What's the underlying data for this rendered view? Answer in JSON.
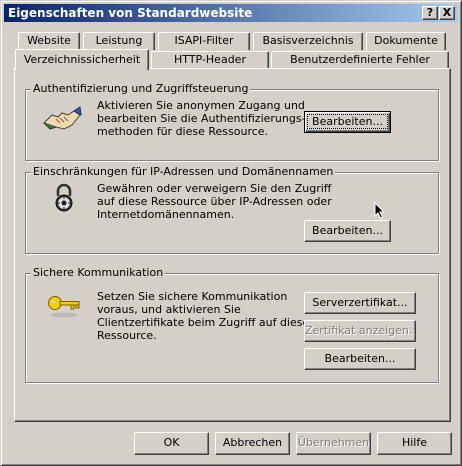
{
  "window": {
    "title": "Eigenschaften von Standardwebsite"
  },
  "title_buttons": {
    "help": "?",
    "close": "X"
  },
  "tabs_back": [
    "Website",
    "Leistung",
    "ISAPI-Filter",
    "Basisverzeichnis",
    "Dokumente"
  ],
  "tabs_front": [
    "Verzeichnissicherheit",
    "HTTP-Header",
    "Benutzerdefinierte Fehler"
  ],
  "sections": {
    "auth": {
      "title": "Authentifizierung und Zugriffsteuerung",
      "text": [
        "Aktivieren Sie anonymen Zugang und",
        "bearbeiten Sie die Authentifizierungs-",
        "methoden für diese Ressource."
      ],
      "button": "Bearbeiten..."
    },
    "ip": {
      "title": "Einschränkungen für IP-Adressen und Domänennamen",
      "text": [
        "Gewähren oder verweigern Sie den Zugriff",
        "auf diese Ressource über IP-Adressen oder",
        "Internetdomänennamen."
      ],
      "button": "Bearbeiten..."
    },
    "secure": {
      "title": "Sichere Kommunikation",
      "text": [
        "Setzen Sie sichere Kommunikation",
        "voraus, und aktivieren Sie",
        "Clientzertifikate beim Zugriff auf diese",
        "Ressource."
      ],
      "buttons": {
        "server_cert": "Serverzertifikat...",
        "view_cert": "Zertifikat anzeigen...",
        "edit": "Bearbeiten..."
      }
    }
  },
  "footer": {
    "ok": "OK",
    "cancel": "Abbrechen",
    "apply": "Übernehmen",
    "help": "Hilfe"
  },
  "icons": {
    "auth": "handshake-icon",
    "ip": "padlock-icon",
    "secure": "key-icon"
  }
}
